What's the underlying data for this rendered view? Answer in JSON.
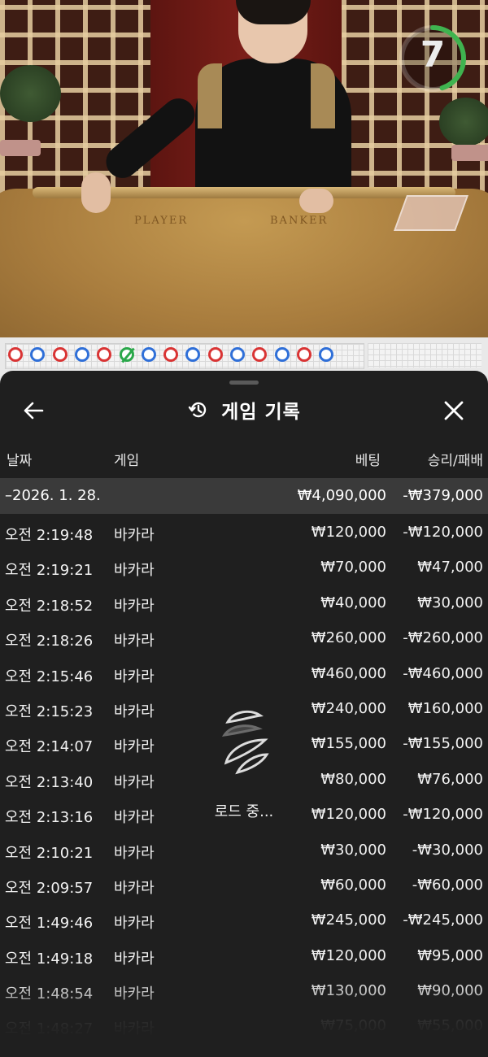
{
  "video": {
    "table_labels": {
      "player": "PLAYER",
      "banker": "BANKER"
    },
    "countdown": "7",
    "countdown_color": "#3fb34f",
    "countdown_fraction_remaining": 0.45
  },
  "roadmap": {
    "results": [
      "red",
      "blue",
      "red",
      "blue",
      "red",
      "tie-green",
      "blue",
      "red",
      "blue",
      "red",
      "blue",
      "red",
      "blue",
      "red",
      "blue-partial"
    ],
    "colors": {
      "red": "#d93434",
      "blue": "#2f6fd8",
      "tie": "#2aa84a"
    }
  },
  "sheet": {
    "title": "게임 기록",
    "icons": {
      "back": "back-arrow-icon",
      "history": "history-icon",
      "close": "close-icon"
    },
    "columns": {
      "date": "날짜",
      "game": "게임",
      "bet": "베팅",
      "result": "승리/패배"
    },
    "day_summary": {
      "date": "–2026. 1. 28.",
      "bet": "₩4,090,000",
      "result": "-₩379,000"
    },
    "rows": [
      {
        "time": "오전 2:19:48",
        "game": "바카라",
        "bet": "₩120,000",
        "result": "-₩120,000"
      },
      {
        "time": "오전 2:19:21",
        "game": "바카라",
        "bet": "₩70,000",
        "result": "₩47,000"
      },
      {
        "time": "오전 2:18:52",
        "game": "바카라",
        "bet": "₩40,000",
        "result": "₩30,000"
      },
      {
        "time": "오전 2:18:26",
        "game": "바카라",
        "bet": "₩260,000",
        "result": "-₩260,000"
      },
      {
        "time": "오전 2:15:46",
        "game": "바카라",
        "bet": "₩460,000",
        "result": "-₩460,000"
      },
      {
        "time": "오전 2:15:23",
        "game": "바카라",
        "bet": "₩240,000",
        "result": "₩160,000"
      },
      {
        "time": "오전 2:14:07",
        "game": "바카라",
        "bet": "₩155,000",
        "result": "-₩155,000"
      },
      {
        "time": "오전 2:13:40",
        "game": "바카라",
        "bet": "₩80,000",
        "result": "₩76,000"
      },
      {
        "time": "오전 2:13:16",
        "game": "바카라",
        "bet": "₩120,000",
        "result": "-₩120,000"
      },
      {
        "time": "오전 2:10:21",
        "game": "바카라",
        "bet": "₩30,000",
        "result": "-₩30,000"
      },
      {
        "time": "오전 2:09:57",
        "game": "바카라",
        "bet": "₩60,000",
        "result": "-₩60,000"
      },
      {
        "time": "오전 1:49:46",
        "game": "바카라",
        "bet": "₩245,000",
        "result": "-₩245,000"
      },
      {
        "time": "오전 1:49:18",
        "game": "바카라",
        "bet": "₩120,000",
        "result": "₩95,000"
      },
      {
        "time": "오전 1:48:54",
        "game": "바카라",
        "bet": "₩130,000",
        "result": "₩90,000"
      },
      {
        "time": "오전 1:48:27",
        "game": "바카라",
        "bet": "₩75,000",
        "result": "₩55,000"
      }
    ],
    "loading_text": "로드 중..."
  }
}
